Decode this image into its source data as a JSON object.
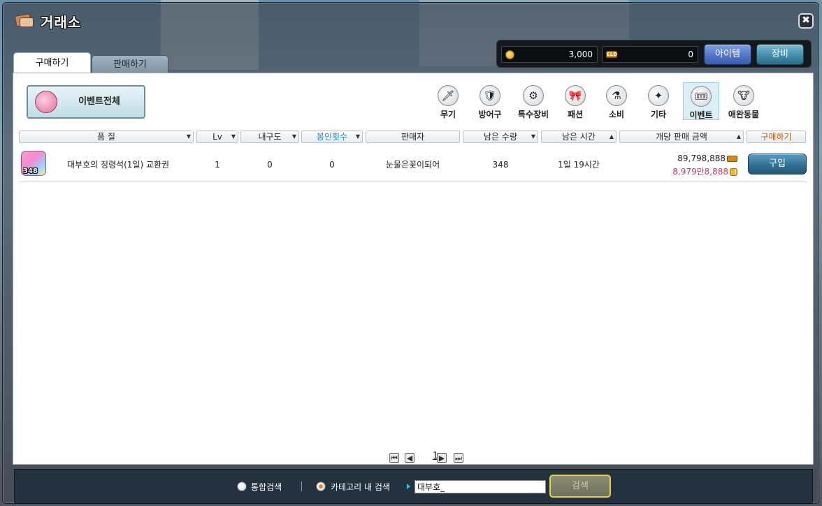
{
  "window": {
    "title": "거래소",
    "close_glyph": "✖"
  },
  "currency": {
    "meso": "3,000",
    "mp": "0",
    "mp_badge": "ELD",
    "item_button": "아이템",
    "equip_button": "장비"
  },
  "tabs": [
    {
      "label": "구매하기",
      "active": true
    },
    {
      "label": "판매하기",
      "active": false
    }
  ],
  "event_all_button": "이벤트전체",
  "categories": [
    {
      "label": "무기",
      "icon": "sword-icon"
    },
    {
      "label": "방어구",
      "icon": "armor-icon"
    },
    {
      "label": "특수장비",
      "icon": "gear-icon"
    },
    {
      "label": "패션",
      "icon": "bow-icon"
    },
    {
      "label": "소비",
      "icon": "potion-icon"
    },
    {
      "label": "기타",
      "icon": "misc-icon"
    },
    {
      "label": "이벤트",
      "icon": "ticket-icon",
      "active": true
    },
    {
      "label": "애완동물",
      "icon": "pet-icon"
    }
  ],
  "columns": {
    "quality": "품 질",
    "lv": "Lv",
    "durability": "내구도",
    "seal_count": "봉인횟수",
    "seller": "판매자",
    "remaining_qty": "남은 수량",
    "remaining_time": "남은 시간",
    "unit_price": "개당 판매 금액",
    "buy": "구매하기"
  },
  "rows": [
    {
      "icon_count": "348",
      "name": "대부호의 정령석(1일) 교환권",
      "lv": "1",
      "durability": "0",
      "seal_count": "0",
      "seller": "눈물은꽃이되어",
      "remaining_qty": "348",
      "remaining_time": "1일 19시간",
      "price": "89,798,888",
      "price_short": "8,979만8,888",
      "buy_label": "구입"
    }
  ],
  "pager": {
    "current": "1"
  },
  "search": {
    "option_all": "통합검색",
    "option_category": "카테고리 내 검색",
    "value": "대부호_",
    "button": "검색"
  },
  "colors": {
    "accent_blue": "#4f72c8",
    "price_pink": "#c23b6d",
    "search_border": "#e5d44a"
  }
}
